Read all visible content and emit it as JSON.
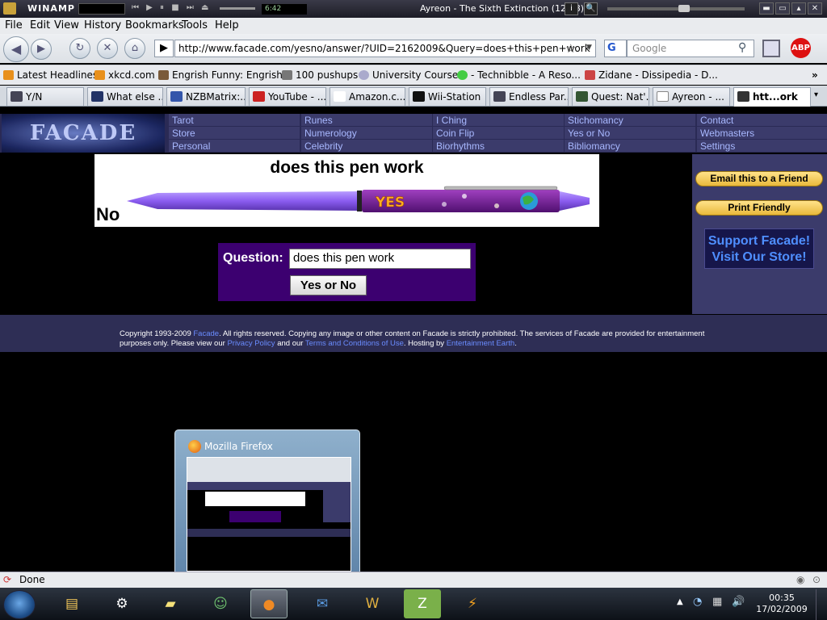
{
  "winamp": {
    "app": "WINAMP",
    "time": "6:42",
    "track": "Ayreon - The Sixth Extinction (12:18)",
    "info_btn": "i",
    "search_btn": "🔍"
  },
  "menu": [
    "File",
    "Edit",
    "View",
    "History",
    "Bookmarks",
    "Tools",
    "Help"
  ],
  "nav": {
    "url": "http://www.facade.com/yesno/answer/?UID=2162009&Query=does+this+pen+work",
    "search_placeholder": "Google",
    "search_engine": "G",
    "abp": "ABP"
  },
  "bookmarks": [
    {
      "label": "Latest Headlines",
      "icon": "rss-icon",
      "color": "#e8901c"
    },
    {
      "label": "xkcd.com",
      "icon": "rss-icon",
      "color": "#e8901c"
    },
    {
      "label": "Engrish Funny: Engrish...",
      "icon": "robot-icon",
      "color": "#7a5a3a"
    },
    {
      "label": "100 pushups",
      "icon": "pushup-icon",
      "color": "#777"
    },
    {
      "label": "University Courses",
      "icon": "globe-icon",
      "color": "#aac"
    },
    {
      "label": "- Technibble - A Reso...",
      "icon": "technibble-icon",
      "color": "#4c4"
    },
    {
      "label": "Zidane - Dissipedia - D...",
      "icon": "wiki-icon",
      "color": "#c44"
    }
  ],
  "tabs": [
    {
      "label": "Y/N"
    },
    {
      "label": "What else ..."
    },
    {
      "label": "NZBMatrix:..."
    },
    {
      "label": "YouTube - ..."
    },
    {
      "label": "Amazon.c..."
    },
    {
      "label": "Wii-Station"
    },
    {
      "label": "Endless Par..."
    },
    {
      "label": "Quest: Nat'..."
    },
    {
      "label": "Ayreon - ..."
    },
    {
      "label": "htt...ork"
    }
  ],
  "site": {
    "logo": "FACADE",
    "nav": [
      [
        "Tarot",
        "Runes",
        "I Ching",
        "Stichomancy",
        "Contact"
      ],
      [
        "Store",
        "Numerology",
        "Coin Flip",
        "Yes or No",
        "Webmasters"
      ],
      [
        "Personal",
        "Celebrity",
        "Biorhythms",
        "Bibliomancy",
        "Settings"
      ]
    ],
    "question_heading": "does this pen work",
    "answer": "No",
    "pen_text": "YES",
    "form_label": "Question:",
    "form_value": "does this pen work",
    "form_button": "Yes or No",
    "email_btn": "Email this to a Friend",
    "print_btn": "Print Friendly",
    "support_line1": "Support Facade!",
    "support_line2": "Visit Our Store!",
    "footer": {
      "p1": "Copyright 1993-2009 ",
      "l1": "Facade",
      "p2": ". All rights reserved. Copying any image or other content on Facade is strictly prohibited. The services of Facade are provided for entertainment purposes only. Please view our ",
      "l2": "Privacy Policy",
      "p3": " and our ",
      "l3": "Terms and Conditions of Use",
      "p4": ". Hosting by ",
      "l4": "Entertainment Earth",
      "p5": "."
    }
  },
  "thumbnail": {
    "title": "Mozilla Firefox"
  },
  "status": {
    "text": "Done"
  },
  "clock": {
    "time": "00:35",
    "date": "17/02/2009"
  }
}
